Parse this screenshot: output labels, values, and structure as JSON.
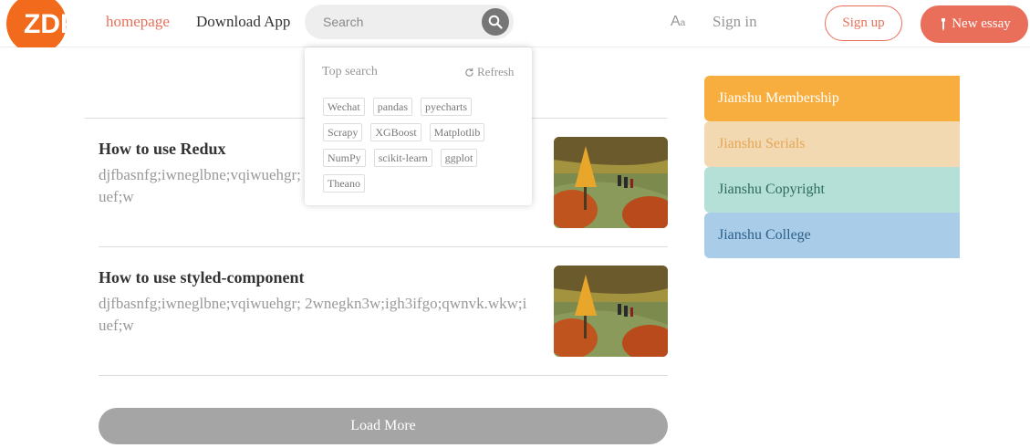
{
  "header": {
    "logo_text": "ZDF",
    "nav_home": "homepage",
    "nav_download": "Download App",
    "search_placeholder": "Search",
    "font_toggle": "A",
    "font_toggle_small": "a",
    "sign_in": "Sign in",
    "sign_up": "Sign up",
    "new_essay": "New essay"
  },
  "search_popup": {
    "title": "Top search",
    "refresh": "Refresh",
    "tags": [
      "Wechat",
      "pandas",
      "pyecharts",
      "Scrapy",
      "XGBoost",
      "Matplotlib",
      "NumPy",
      "scikit-learn",
      "ggplot",
      "Theano"
    ]
  },
  "articles": [
    {
      "title": "How to use Redux",
      "desc": "djfbasnfg;iwneglbne;vqiwuehgr; 2wnegkn3w;igh3ifgo;qwnvk.wkw;iuef;w"
    },
    {
      "title": "How to use styled-component",
      "desc": "djfbasnfg;iwneglbne;vqiwuehgr; 2wnegkn3w;igh3ifgo;qwnvk.wkw;iuef;w"
    }
  ],
  "load_more": "Load More",
  "boards": [
    {
      "label": "Jianshu Membership",
      "bg": "#f7ae3e",
      "color": "#ffffff"
    },
    {
      "label": "Jianshu Serials",
      "bg": "#f3d9b1",
      "color": "#e4a758"
    },
    {
      "label": "Jianshu Copyright",
      "bg": "#b4e0d8",
      "color": "#2f6b5e"
    },
    {
      "label": "Jianshu College",
      "bg": "#a9cde8",
      "color": "#2e5f8a"
    }
  ],
  "colors": {
    "accent": "#ea6f5a",
    "logo": "#f26a1b"
  }
}
